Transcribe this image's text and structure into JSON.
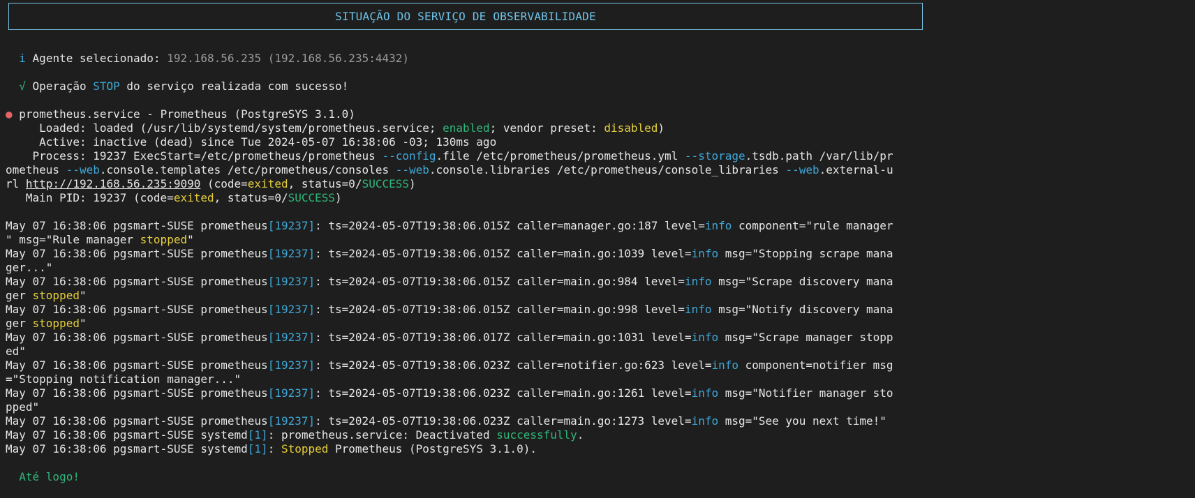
{
  "header": {
    "title": "SITUAÇÃO DO SERVIÇO DE OBSERVABILIDADE"
  },
  "agent_line": {
    "icon_char": "i",
    "label": "Agente selecionado:",
    "value": "192.168.56.235 (192.168.56.235:4432)"
  },
  "operation_line": {
    "icon_char": "√",
    "prefix": "Operação",
    "op": "STOP",
    "suffix": "do serviço realizada com sucesso!"
  },
  "status": {
    "dot": "●",
    "unit_line": "prometheus.service - Prometheus (PostgreSYS 3.1.0)",
    "loaded": {
      "prefix": "     Loaded: loaded (/usr/lib/systemd/system/prometheus.service; ",
      "enabled": "enabled",
      "middle": "; vendor preset: ",
      "disabled": "disabled",
      "end": ")"
    },
    "active": "     Active: inactive (dead) since Tue 2024-05-07 16:38:06 -03; 130ms ago",
    "process": {
      "l1_a": "    Process: 19237 ExecStart=/etc/prometheus/prometheus ",
      "l1_flag1": "--config",
      "l1_b": ".file /etc/prometheus/prometheus.yml ",
      "l1_flag2": "--storage",
      "l1_c": ".tsdb.path /var/lib/pr",
      "l2_a": "ometheus ",
      "l2_flag1": "--web",
      "l2_b": ".console.templates /etc/prometheus/consoles ",
      "l2_flag2": "--web",
      "l2_c": ".console.libraries /etc/prometheus/console_libraries ",
      "l2_flag3": "--web",
      "l2_d": ".external-u",
      "l3_a": "rl ",
      "l3_link": "http://192.168.56.235:9090",
      "l3_b": " (code=",
      "l3_exited": "exited",
      "l3_c": ", status=0/",
      "l3_success": "SUCCESS",
      "l3_d": ")"
    },
    "mainpid": {
      "a": "   Main PID: 19237 (code=",
      "exited": "exited",
      "b": ", status=0/",
      "success": "SUCCESS",
      "c": ")"
    }
  },
  "logs": {
    "prefix": "May 07 16:38:06 pgsmart-SUSE prometheus",
    "pid": "[19237]",
    "info": "info",
    "stopped": "stopped",
    "l1": {
      "a": ": ts=2024-05-07T19:38:06.015Z caller=manager.go:187 level=",
      "b": " component=\"rule manager",
      "c2a": "\" msg=\"Rule manager ",
      "c2b": "\""
    },
    "l2": {
      "a": ": ts=2024-05-07T19:38:06.015Z caller=main.go:1039 level=",
      "b": " msg=\"Stopping scrape mana",
      "c2": "ger...\""
    },
    "l3": {
      "a": ": ts=2024-05-07T19:38:06.015Z caller=main.go:984 level=",
      "b": " msg=\"Scrape discovery mana",
      "c2a": "ger ",
      "c2b": "\""
    },
    "l4": {
      "a": ": ts=2024-05-07T19:38:06.015Z caller=main.go:998 level=",
      "b": " msg=\"Notify discovery mana",
      "c2a": "ger ",
      "c2b": "\""
    },
    "l5": {
      "a": ": ts=2024-05-07T19:38:06.017Z caller=main.go:1031 level=",
      "b": " msg=\"Scrape manager stopp",
      "c2": "ed\""
    },
    "l6": {
      "a": ": ts=2024-05-07T19:38:06.023Z caller=notifier.go:623 level=",
      "b": " component=notifier msg",
      "c2": "=\"Stopping notification manager...\""
    },
    "l7": {
      "a": ": ts=2024-05-07T19:38:06.023Z caller=main.go:1261 level=",
      "b": " msg=\"Notifier manager sto",
      "c2": "pped\""
    },
    "l8": {
      "a": ": ts=2024-05-07T19:38:06.023Z caller=main.go:1273 level=",
      "b": " msg=\"See you next time!\""
    },
    "systemd_prefix": "May 07 16:38:06 pgsmart-SUSE systemd",
    "systemd_pid": "[1]",
    "s1": {
      "a": ": prometheus.service: Deactivated ",
      "green": "successfully",
      "b": "."
    },
    "s2": {
      "a": ": ",
      "yellow": "Stopped",
      "b": " Prometheus (PostgreSYS 3.1.0)."
    }
  },
  "footer": {
    "farewell": "Até logo!"
  }
}
